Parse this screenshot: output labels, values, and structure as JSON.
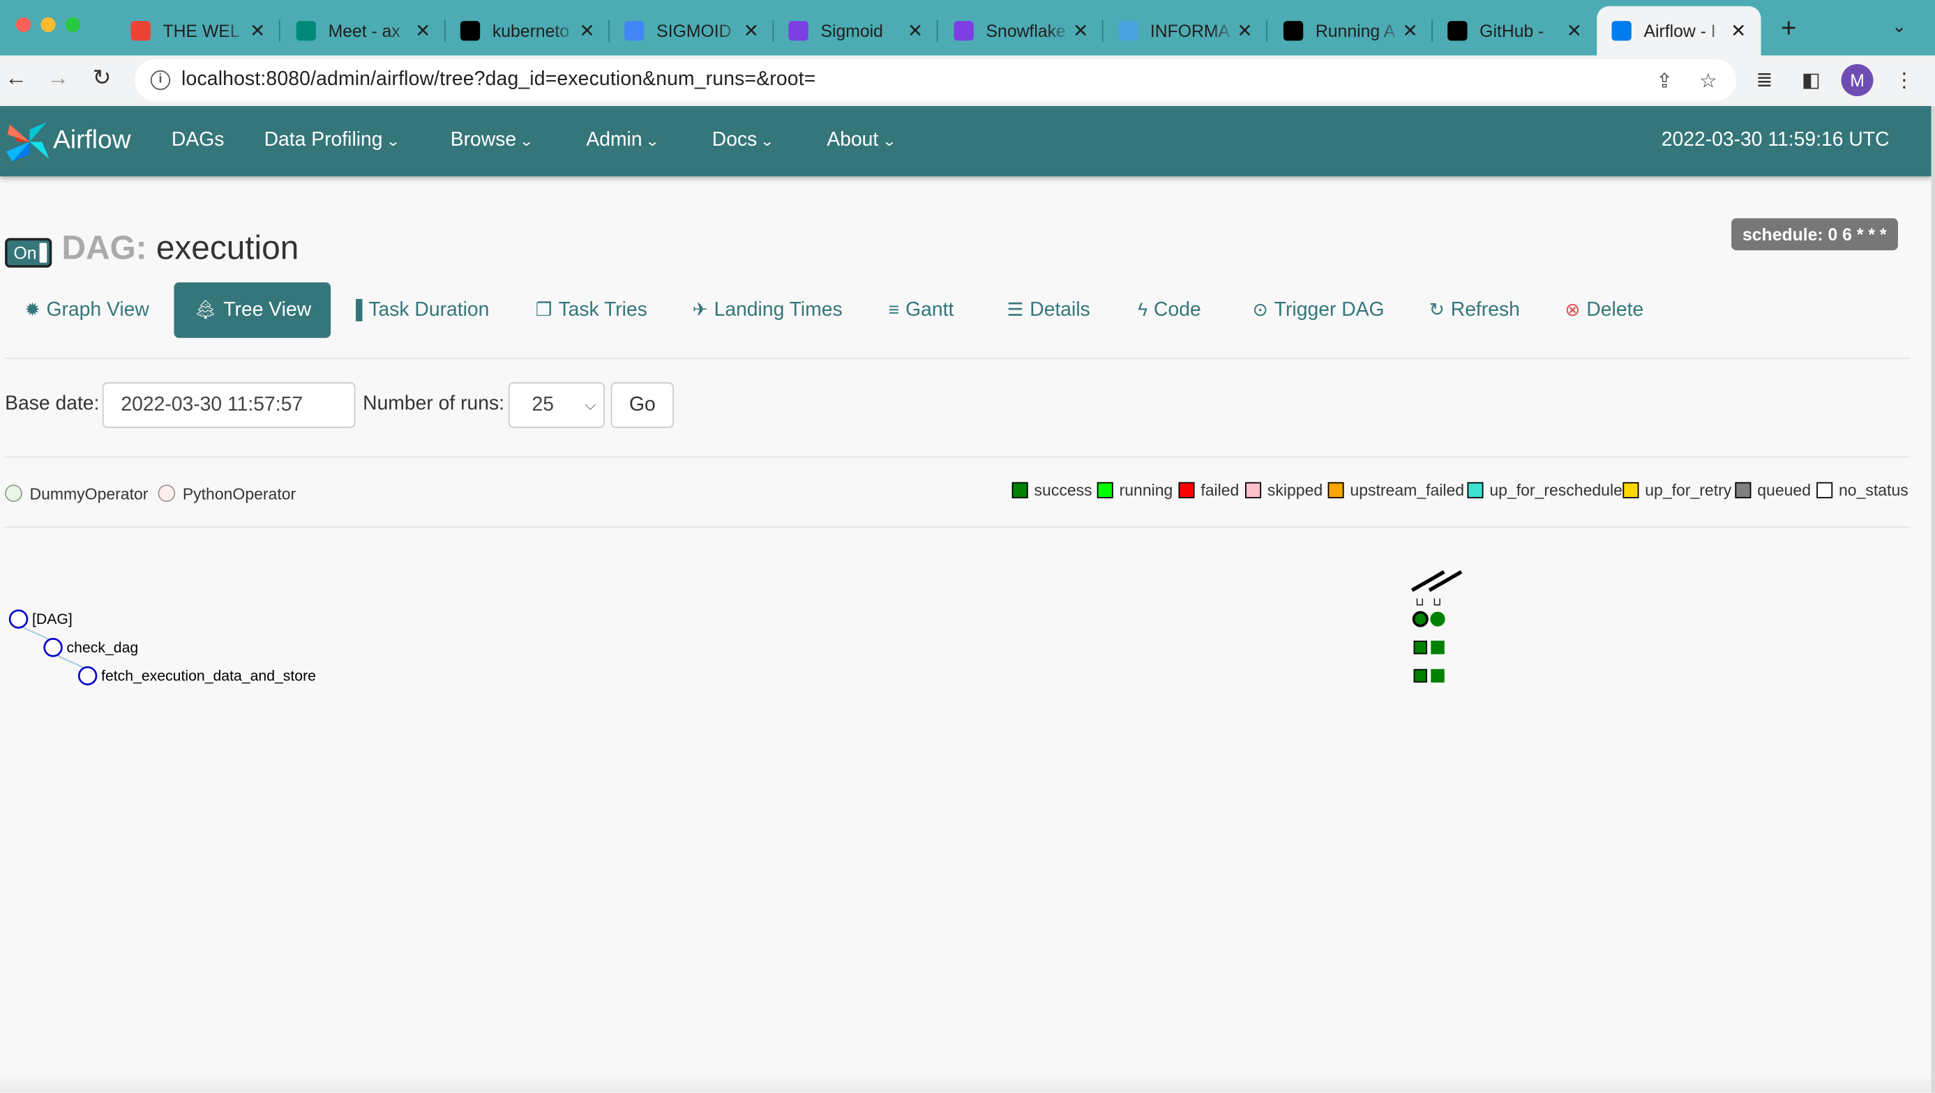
{
  "browser": {
    "tabs": [
      {
        "title": "THE WEL",
        "icon": "gmail-icon",
        "color": "#ea4335"
      },
      {
        "title": "Meet - ax",
        "icon": "google-meet-icon",
        "color": "#00897b"
      },
      {
        "title": "kuberneto",
        "icon": "github-icon",
        "color": "#000000"
      },
      {
        "title": "SIGMOID",
        "icon": "google-calendar-icon",
        "color": "#4285f4"
      },
      {
        "title": "Sigmoid",
        "icon": "sigmoid-icon",
        "color": "#7b3fe4"
      },
      {
        "title": "Snowflake",
        "icon": "sigmoid-icon",
        "color": "#7b3fe4"
      },
      {
        "title": "INFORMA",
        "icon": "globe-icon",
        "color": "#4aa3df"
      },
      {
        "title": "Running A",
        "icon": "web-icon",
        "color": "#000000"
      },
      {
        "title": "GitHub -",
        "icon": "github-icon",
        "color": "#000000"
      },
      {
        "title": "Airflow - I",
        "icon": "airflow-icon",
        "color": "#017cee"
      }
    ],
    "url": "localhost:8080/admin/airflow/tree?dag_id=execution&num_runs=&root=",
    "profile_initial": "M"
  },
  "navbar": {
    "brand": "Airflow",
    "items": [
      {
        "label": "DAGs",
        "dropdown": false
      },
      {
        "label": "Data Profiling",
        "dropdown": true
      },
      {
        "label": "Browse",
        "dropdown": true
      },
      {
        "label": "Admin",
        "dropdown": true
      },
      {
        "label": "Docs",
        "dropdown": true
      },
      {
        "label": "About",
        "dropdown": true
      }
    ],
    "clock": "2022-03-30 11:59:16 UTC"
  },
  "dag": {
    "toggle": "On",
    "label": "DAG:",
    "id": "execution",
    "schedule": "schedule: 0 6 * * *"
  },
  "views": [
    {
      "label": "Graph View",
      "icon": "asterisk-icon",
      "glyph": "✹"
    },
    {
      "label": "Tree View",
      "icon": "tree-icon",
      "glyph": "🌲︎",
      "active": true
    },
    {
      "label": "Task Duration",
      "icon": "bar-chart-icon",
      "glyph": "▐"
    },
    {
      "label": "Task Tries",
      "icon": "duplicate-icon",
      "glyph": "❐"
    },
    {
      "label": "Landing Times",
      "icon": "plane-icon",
      "glyph": "✈"
    },
    {
      "label": "Gantt",
      "icon": "align-left-icon",
      "glyph": "≡"
    },
    {
      "label": "Details",
      "icon": "list-icon",
      "glyph": "☰"
    },
    {
      "label": "Code",
      "icon": "flash-icon",
      "glyph": "ϟ"
    },
    {
      "label": "Trigger DAG",
      "icon": "play-circle-icon",
      "glyph": "⊙"
    },
    {
      "label": "Refresh",
      "icon": "refresh-icon",
      "glyph": "↻"
    },
    {
      "label": "Delete",
      "icon": "remove-circle-icon",
      "glyph": "⊗"
    }
  ],
  "form": {
    "base_date_label": "Base date:",
    "base_date": "2022-03-30 11:57:57",
    "runs_label": "Number of runs:",
    "runs_value": "25",
    "go_label": "Go"
  },
  "operators": [
    {
      "name": "DummyOperator",
      "color": "#e8f7e4"
    },
    {
      "name": "PythonOperator",
      "color": "#ffefeb"
    }
  ],
  "legend": [
    {
      "state": "success",
      "color": "#008000"
    },
    {
      "state": "running",
      "color": "#00ff00"
    },
    {
      "state": "failed",
      "color": "#ff0000"
    },
    {
      "state": "skipped",
      "color": "#ffc0cb"
    },
    {
      "state": "upstream_failed",
      "color": "#ffa500"
    },
    {
      "state": "up_for_reschedule",
      "color": "#40e0d0"
    },
    {
      "state": "up_for_retry",
      "color": "#ffd700"
    },
    {
      "state": "queued",
      "color": "#808080"
    },
    {
      "state": "no_status",
      "color": "#ffffff"
    }
  ],
  "tree": {
    "nodes": [
      {
        "label": "[DAG]",
        "depth": 0
      },
      {
        "label": "check_dag",
        "depth": 1
      },
      {
        "label": "fetch_execution_data_and_store",
        "depth": 2
      }
    ],
    "runs": [
      {
        "state": "success"
      },
      {
        "state": "success"
      }
    ]
  }
}
